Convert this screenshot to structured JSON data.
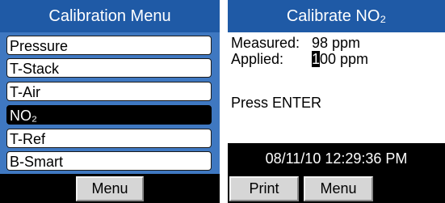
{
  "left_screen": {
    "title": "Calibration Menu",
    "items": [
      {
        "label": "Pressure"
      },
      {
        "label": "T-Stack"
      },
      {
        "label": "T-Air"
      },
      {
        "label": "NO₂"
      },
      {
        "label": "T-Ref"
      },
      {
        "label": "B-Smart"
      }
    ],
    "selected_index": 3,
    "softkeys": {
      "menu": "Menu"
    }
  },
  "right_screen": {
    "title": "Calibrate NO₂",
    "measured": {
      "label": "Measured:",
      "value": "98 ppm"
    },
    "applied": {
      "label": "Applied:",
      "cursor_digit": "1",
      "rest": "00 ppm"
    },
    "instruction": "Press ENTER",
    "datetime": "08/11/10 12:29:36 PM",
    "softkeys": {
      "print": "Print",
      "menu": "Menu"
    }
  },
  "colors": {
    "title_bar": "#1f5aa6",
    "menu_background": "#3f78c1",
    "selected_item": "#000000",
    "softkey": "#d6d6d6"
  }
}
